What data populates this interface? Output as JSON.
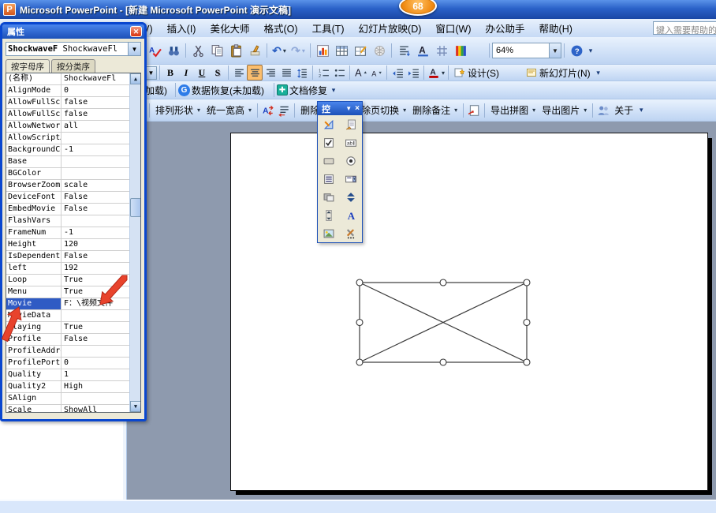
{
  "window": {
    "title": "Microsoft PowerPoint - [新建 Microsoft PowerPoint 演示文稿]",
    "badge": "68"
  },
  "menu": {
    "items": [
      "视图(V)",
      "插入(I)",
      "美化大师",
      "格式(O)",
      "工具(T)",
      "幻灯片放映(D)",
      "窗口(W)",
      "办公助手",
      "帮助(H)"
    ],
    "help_placeholder": "键入需要帮助的"
  },
  "standard_toolbar": {
    "zoom_value": "64%",
    "icons": [
      "spellcheck-icon",
      "search-icon",
      "cut-icon",
      "copy-icon",
      "paste-icon",
      "format-painter-icon",
      "undo-icon",
      "redo-icon",
      "insert-chart-icon",
      "insert-table-icon",
      "draw-table-icon",
      "hyperlink-icon",
      "show-formatting-icon",
      "character-format-icon",
      "grid-icon",
      "color-scheme-icon",
      "help-icon"
    ]
  },
  "formatting_toolbar": {
    "bold": "B",
    "italic": "I",
    "underline": "U",
    "shadow": "S",
    "design": "设计(S)",
    "new_slide": "新幻灯片(N)"
  },
  "recovery_toolbar": {
    "left_partial": "(未加载)",
    "data_recovery": "数据恢复(未加载)",
    "doc_repair": "文档修复"
  },
  "custom_toolbar": {
    "arrange": "排列形状",
    "unify": "统一宽高",
    "delete_animation": "删除动画",
    "delete_transition": "删除页切换",
    "delete_notes": "删除备注",
    "export_puzzle": "导出拼图",
    "export_picture": "导出图片",
    "about": "关于"
  },
  "properties_panel": {
    "title": "属性",
    "selector_bold": "ShockwaveF",
    "selector_rest": "ShockwaveFl",
    "tabs": [
      "按字母序",
      "按分类序"
    ],
    "rows": [
      {
        "n": "(名称)",
        "v": "ShockwaveFl"
      },
      {
        "n": "AlignMode",
        "v": "0"
      },
      {
        "n": "AllowFullScr",
        "v": "false"
      },
      {
        "n": "AllowFullScr",
        "v": "false"
      },
      {
        "n": "AllowNetwork",
        "v": "all"
      },
      {
        "n": "AllowScriptA",
        "v": ""
      },
      {
        "n": "BackgroundCo",
        "v": "-1"
      },
      {
        "n": "Base",
        "v": ""
      },
      {
        "n": "BGColor",
        "v": ""
      },
      {
        "n": "BrowserZoom",
        "v": "scale"
      },
      {
        "n": "DeviceFont",
        "v": "False"
      },
      {
        "n": "EmbedMovie",
        "v": "False"
      },
      {
        "n": "FlashVars",
        "v": ""
      },
      {
        "n": "FrameNum",
        "v": "-1"
      },
      {
        "n": "Height",
        "v": "120"
      },
      {
        "n": "IsDependent",
        "v": "False"
      },
      {
        "n": "left",
        "v": "192"
      },
      {
        "n": "Loop",
        "v": "True"
      },
      {
        "n": "Menu",
        "v": "True"
      },
      {
        "n": "Movie",
        "v": "F：\\视频文件",
        "sel": true
      },
      {
        "n": "MovieData",
        "v": ""
      },
      {
        "n": "Playing",
        "v": "True"
      },
      {
        "n": "Profile",
        "v": "False"
      },
      {
        "n": "ProfileAddre",
        "v": ""
      },
      {
        "n": "ProfilePort",
        "v": "0"
      },
      {
        "n": "Quality",
        "v": "1"
      },
      {
        "n": "Quality2",
        "v": "High"
      },
      {
        "n": "SAlign",
        "v": ""
      },
      {
        "n": "Scale",
        "v": "ShowAll"
      }
    ]
  },
  "toolbox": {
    "title": "控",
    "controls": [
      "design-mode",
      "properties",
      "checkbox",
      "textbox",
      "command-button",
      "option-button",
      "list-box",
      "combo-box",
      "toggle-button",
      "spin-button",
      "scrollbar",
      "label",
      "image",
      "more-controls"
    ]
  },
  "colors": {
    "selection": "#2F5BC4",
    "annotation_arrow": "#E8432C",
    "badge": "#F08A12",
    "workspace": "#8E9AAE"
  }
}
